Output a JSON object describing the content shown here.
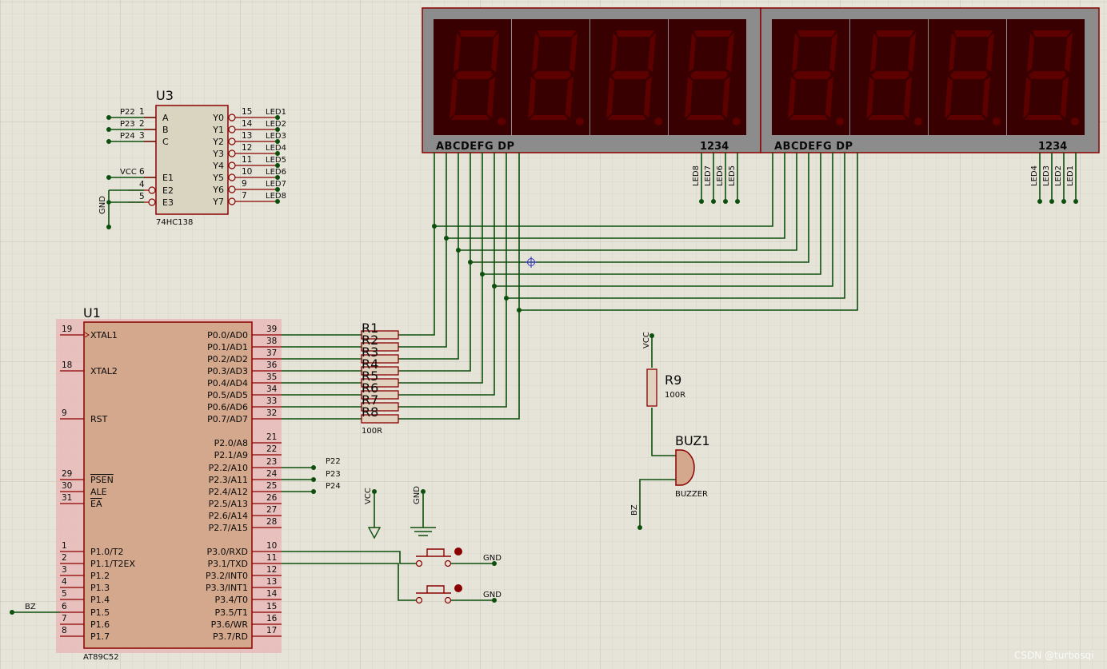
{
  "u1": {
    "ref": "U1",
    "part": "AT89C52",
    "left_pins": [
      {
        "num": "19",
        "name": "XTAL1"
      },
      {
        "num": "18",
        "name": "XTAL2"
      },
      {
        "num": "9",
        "name": "RST"
      },
      {
        "num": "29",
        "name": "PSEN"
      },
      {
        "num": "30",
        "name": "ALE"
      },
      {
        "num": "31",
        "name": "EA"
      },
      {
        "num": "1",
        "name": "P1.0/T2"
      },
      {
        "num": "2",
        "name": "P1.1/T2EX"
      },
      {
        "num": "3",
        "name": "P1.2"
      },
      {
        "num": "4",
        "name": "P1.3"
      },
      {
        "num": "5",
        "name": "P1.4"
      },
      {
        "num": "6",
        "name": "P1.5"
      },
      {
        "num": "7",
        "name": "P1.6"
      },
      {
        "num": "8",
        "name": "P1.7"
      }
    ],
    "right_pins": [
      {
        "num": "39",
        "name": "P0.0/AD0"
      },
      {
        "num": "38",
        "name": "P0.1/AD1"
      },
      {
        "num": "37",
        "name": "P0.2/AD2"
      },
      {
        "num": "36",
        "name": "P0.3/AD3"
      },
      {
        "num": "35",
        "name": "P0.4/AD4"
      },
      {
        "num": "34",
        "name": "P0.5/AD5"
      },
      {
        "num": "33",
        "name": "P0.6/AD6"
      },
      {
        "num": "32",
        "name": "P0.7/AD7"
      },
      {
        "num": "21",
        "name": "P2.0/A8"
      },
      {
        "num": "22",
        "name": "P2.1/A9"
      },
      {
        "num": "23",
        "name": "P2.2/A10"
      },
      {
        "num": "24",
        "name": "P2.3/A11"
      },
      {
        "num": "25",
        "name": "P2.4/A12"
      },
      {
        "num": "26",
        "name": "P2.5/A13"
      },
      {
        "num": "27",
        "name": "P2.6/A14"
      },
      {
        "num": "28",
        "name": "P2.7/A15"
      },
      {
        "num": "10",
        "name": "P3.0/RXD"
      },
      {
        "num": "11",
        "name": "P3.1/TXD"
      },
      {
        "num": "12",
        "name": "P3.2/INT0"
      },
      {
        "num": "13",
        "name": "P3.3/INT1"
      },
      {
        "num": "14",
        "name": "P3.4/T0"
      },
      {
        "num": "15",
        "name": "P3.5/T1"
      },
      {
        "num": "16",
        "name": "P3.6/WR"
      },
      {
        "num": "17",
        "name": "P3.7/RD"
      }
    ]
  },
  "u3": {
    "ref": "U3",
    "part": "74HC138",
    "inputs": [
      {
        "num": "1",
        "name": "A",
        "net": "P22"
      },
      {
        "num": "2",
        "name": "B",
        "net": "P23"
      },
      {
        "num": "3",
        "name": "C",
        "net": "P24"
      },
      {
        "num": "6",
        "name": "E1",
        "net": "VCC"
      },
      {
        "num": "4",
        "name": "E2",
        "net": ""
      },
      {
        "num": "5",
        "name": "E3",
        "net": ""
      }
    ],
    "outputs": [
      {
        "num": "15",
        "name": "Y0",
        "net": "LED1"
      },
      {
        "num": "14",
        "name": "Y1",
        "net": "LED2"
      },
      {
        "num": "13",
        "name": "Y2",
        "net": "LED3"
      },
      {
        "num": "12",
        "name": "Y3",
        "net": "LED4"
      },
      {
        "num": "11",
        "name": "Y4",
        "net": "LED5"
      },
      {
        "num": "10",
        "name": "Y5",
        "net": "LED6"
      },
      {
        "num": "9",
        "name": "Y6",
        "net": "LED7"
      },
      {
        "num": "7",
        "name": "Y7",
        "net": "LED8"
      }
    ],
    "gnd_label": "GND"
  },
  "resistors": {
    "labels": [
      "R1",
      "R2",
      "R3",
      "R4",
      "R5",
      "R6",
      "R7",
      "R8"
    ],
    "value": "100R"
  },
  "displays": [
    {
      "segments_label": "ABCDEFG  DP",
      "digits_label": "1234",
      "led_nets": [
        "LED8",
        "LED7",
        "LED6",
        "LED5"
      ]
    },
    {
      "segments_label": "ABCDEFG  DP",
      "digits_label": "1234",
      "led_nets": [
        "LED4",
        "LED3",
        "LED2",
        "LED1"
      ]
    }
  ],
  "p2_nets": [
    "P22",
    "P23",
    "P24"
  ],
  "buttons": {
    "vcc_label": "VCC",
    "gnd_label": "GND",
    "right_gnd": [
      "GND",
      "GND"
    ]
  },
  "buzzer": {
    "vcc_label": "VCC",
    "r_ref": "R9",
    "r_value": "100R",
    "ref": "BUZ1",
    "part": "BUZZER",
    "net": "BZ"
  },
  "bz_left_label": "BZ",
  "watermark": "CSDN @turbosqi",
  "colors": {
    "background": "#e6e4d8",
    "wire": "#0d4f0d",
    "pin": "#8a0000",
    "chip_body": "#d4a88c",
    "display_frame": "#8a8a8a",
    "segment": "#5c0000"
  }
}
